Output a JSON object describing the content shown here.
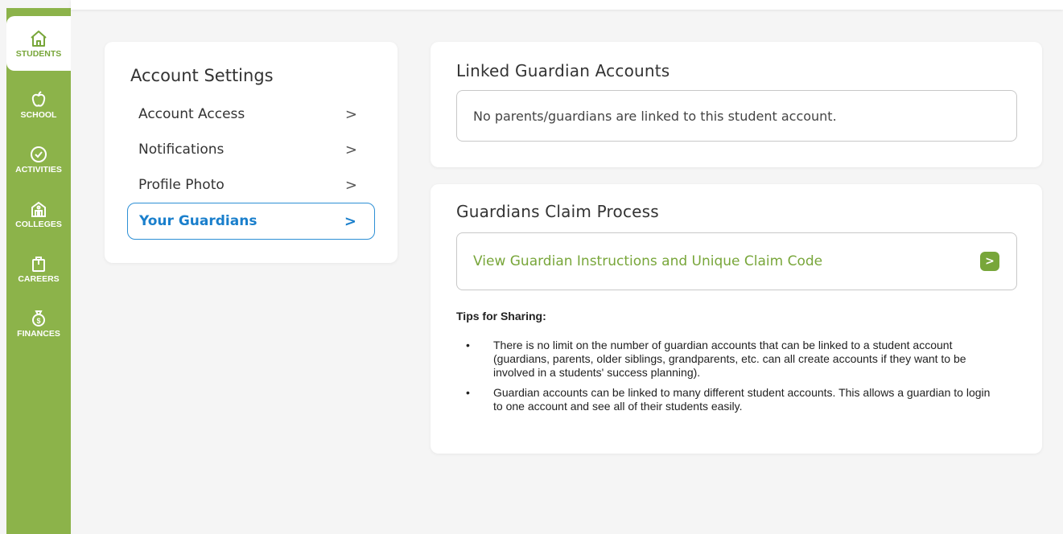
{
  "sidebar": {
    "items": [
      {
        "label": "STUDENTS",
        "icon": "home-icon",
        "active": true
      },
      {
        "label": "SCHOOL",
        "icon": "apple-icon",
        "active": false
      },
      {
        "label": "ACTIVITIES",
        "icon": "check-circle-icon",
        "active": false
      },
      {
        "label": "COLLEGES",
        "icon": "college-building-icon",
        "active": false
      },
      {
        "label": "CAREERS",
        "icon": "briefcase-icon",
        "active": false
      },
      {
        "label": "FINANCES",
        "icon": "money-bag-icon",
        "active": false
      }
    ]
  },
  "settings": {
    "title": "Account Settings",
    "items": [
      {
        "label": "Account Access",
        "chevron": ">"
      },
      {
        "label": "Notifications",
        "chevron": ">"
      },
      {
        "label": "Profile Photo",
        "chevron": ">"
      },
      {
        "label": "Your Guardians",
        "chevron": ">",
        "selected": true
      }
    ]
  },
  "linked": {
    "title": "Linked Guardian Accounts",
    "empty_message": "No parents/guardians are linked to this student account."
  },
  "claim": {
    "title": "Guardians Claim Process",
    "link_label": "View Guardian Instructions and Unique Claim Code",
    "link_arrow": ">",
    "tips_heading": "Tips for Sharing:",
    "bullet": "•",
    "tips": [
      "There is no limit on the number of guardian accounts that can be linked to a student account (guardians, parents, older siblings, grandparents, etc. can all create accounts if they want to be involved in a students' success planning).",
      "Guardian accounts can be linked to many different student accounts. This allows a guardian to login to one account and see all of their students easily."
    ]
  },
  "colors": {
    "brand_green": "#8cb34a",
    "link_green": "#78a63a",
    "selected_blue": "#1a7fcc"
  }
}
